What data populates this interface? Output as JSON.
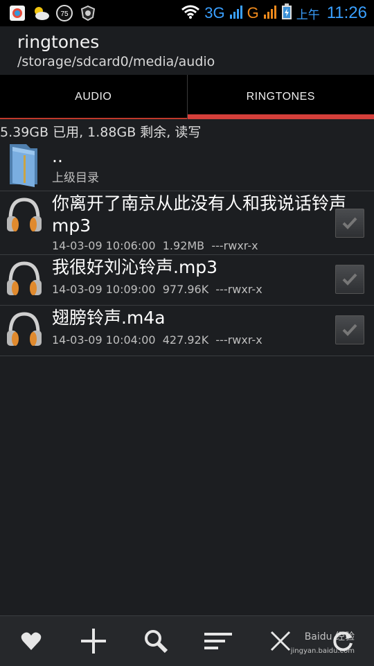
{
  "status_bar": {
    "battery_badge": "75",
    "network_3g": "3G",
    "network_g": "G",
    "ampm": "上午",
    "time": "11:26"
  },
  "header": {
    "title": "ringtones",
    "path": "/storage/sdcard0/media/audio"
  },
  "tabs": [
    {
      "label": "AUDIO"
    },
    {
      "label": "RINGTONES"
    }
  ],
  "storage_info": "5.39GB 已用, 1.88GB 剩余, 读写",
  "parent_dir": {
    "name": "..",
    "label": "上级目录"
  },
  "files": [
    {
      "name": "你离开了南京从此没有人和我说话铃声mp3",
      "date": "14-03-09 10:06:00",
      "size": "1.92MB",
      "perms": "---rwxr-x"
    },
    {
      "name": "我很好刘沁铃声.mp3",
      "date": "14-03-09 10:09:00",
      "size": "977.96K",
      "perms": "---rwxr-x"
    },
    {
      "name": "翅膀铃声.m4a",
      "date": "14-03-09 10:04:00",
      "size": "427.92K",
      "perms": "---rwxr-x"
    }
  ],
  "watermark": {
    "text": "Baidu 经验",
    "url": "jingyan.baidu.com"
  },
  "colors": {
    "accent": "#d43f3a",
    "status_blue": "#3aa0ff",
    "status_orange": "#f08a1c"
  }
}
